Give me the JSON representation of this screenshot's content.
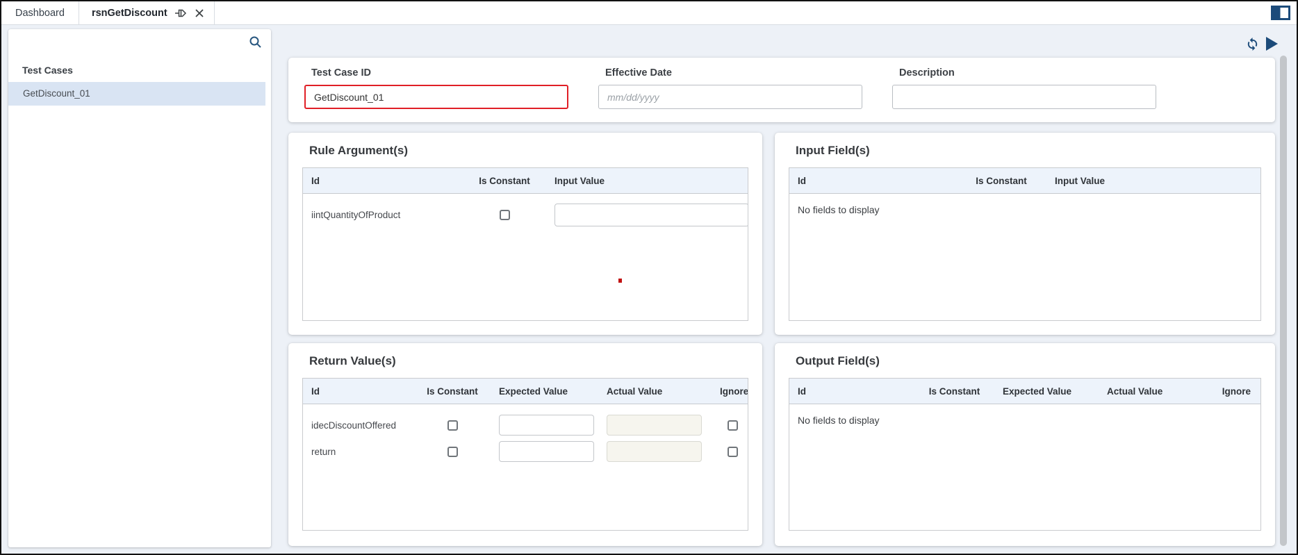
{
  "colors": {
    "accent": "#1c4b7a",
    "error-border": "#e01f26",
    "selected-bg": "#d9e4f3",
    "table-header-bg": "#edf3fb",
    "content-bg": "#edf1f7",
    "disabled-input-bg": "#f6f5ee"
  },
  "tabs": [
    {
      "label": "Dashboard",
      "active": false
    },
    {
      "label": "rsnGetDiscount",
      "active": true,
      "icons": [
        "pin-icon",
        "close-icon"
      ]
    }
  ],
  "window": {
    "panel_toggle_icon": "panel-split-icon"
  },
  "toolbar": {
    "refresh_icon": "refresh-icon",
    "run_icon": "play-icon"
  },
  "sidebar": {
    "search_icon": "search-icon",
    "title": "Test Cases",
    "items": [
      {
        "label": "GetDiscount_01",
        "selected": true
      }
    ]
  },
  "header_fields": {
    "test_case_id": {
      "label": "Test Case ID",
      "value": "GetDiscount_01",
      "error_highlight": true
    },
    "effective_date": {
      "label": "Effective Date",
      "value": "",
      "placeholder": "mm/dd/yyyy"
    },
    "description": {
      "label": "Description",
      "value": ""
    }
  },
  "panels": {
    "rule_arguments": {
      "title": "Rule Argument(s)",
      "columns": [
        "Id",
        "Is Constant",
        "Input Value"
      ],
      "rows": [
        {
          "id": "iintQuantityOfProduct",
          "is_constant": false,
          "input_value": ""
        }
      ]
    },
    "input_fields": {
      "title": "Input Field(s)",
      "columns": [
        "Id",
        "Is Constant",
        "Input Value"
      ],
      "empty_message": "No fields to display"
    },
    "return_values": {
      "title": "Return Value(s)",
      "columns": [
        "Id",
        "Is Constant",
        "Expected Value",
        "Actual Value",
        "Ignore"
      ],
      "rows": [
        {
          "id": "idecDiscountOffered",
          "is_constant": false,
          "expected_value": "",
          "actual_value": "",
          "ignore": false
        },
        {
          "id": "return",
          "is_constant": false,
          "expected_value": "",
          "actual_value": "",
          "ignore": false
        }
      ]
    },
    "output_fields": {
      "title": "Output Field(s)",
      "columns": [
        "Id",
        "Is Constant",
        "Expected Value",
        "Actual Value",
        "Ignore"
      ],
      "empty_message": "No fields to display"
    }
  }
}
